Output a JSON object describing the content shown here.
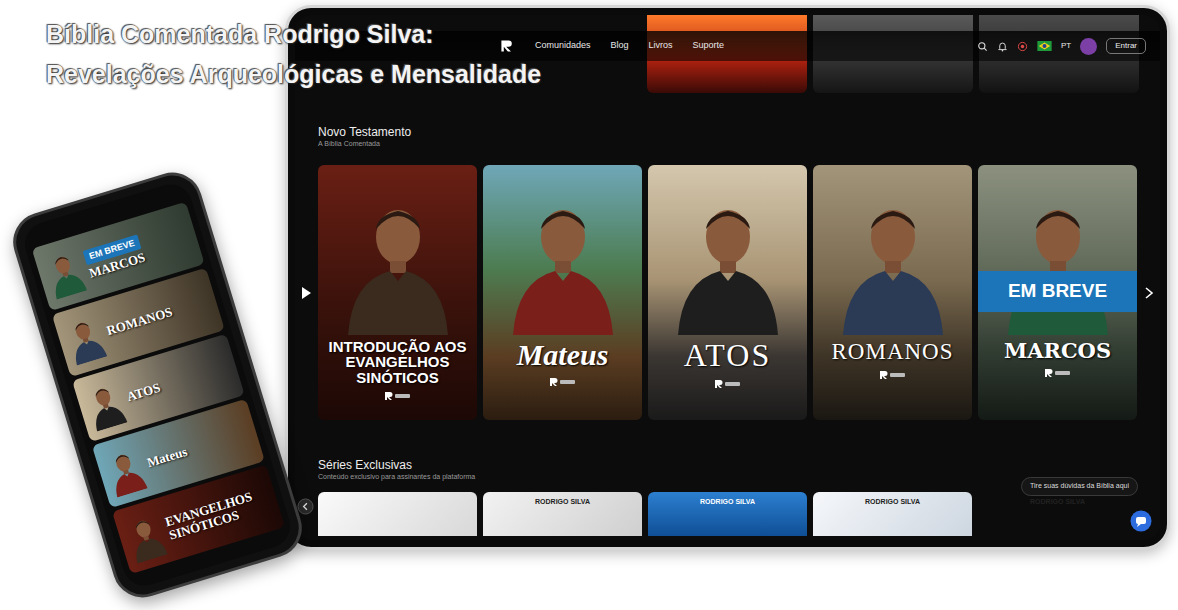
{
  "headline": {
    "line1": "Bíblia Comentada Rodrigo Silva:",
    "line2": "Revelações Arqueológicas e Mensalidade"
  },
  "nav": {
    "items": [
      "Comunidades",
      "Blog",
      "Livros",
      "Suporte"
    ],
    "language": "PT",
    "button": "Entrar"
  },
  "new_testament": {
    "title": "Novo Testamento",
    "subtitle": "A Bíblia Comentada",
    "cards": [
      {
        "title": "INTRODUÇÃO AOS EVANGELHOS SINÓTICOS",
        "coming_soon": false
      },
      {
        "title": "Mateus",
        "coming_soon": false
      },
      {
        "title": "ATOS",
        "coming_soon": false
      },
      {
        "title": "ROMANOS",
        "coming_soon": false
      },
      {
        "title": "MARCOS",
        "coming_soon": true,
        "badge": "EM BREVE"
      }
    ]
  },
  "series": {
    "title": "Séries Exclusivas",
    "subtitle": "Conteúdo exclusivo para assinantes da plataforma",
    "cards": [
      {
        "kind": "image"
      },
      {
        "kind": "labeled",
        "label": "RODRIGO SILVA"
      },
      {
        "kind": "labeled",
        "label": "RODRIGO SILVA"
      },
      {
        "kind": "labeled",
        "label": "RODRIGO SILVA"
      },
      {
        "kind": "labeled",
        "label": "RODRIGO SILVA"
      }
    ]
  },
  "help_tooltip": "Tire suas dúvidas da Bíblia aqui",
  "phone": {
    "tiles": [
      {
        "title": "MARCOS",
        "coming_soon": true,
        "badge": "EM BREVE"
      },
      {
        "title": "ROMANOS",
        "coming_soon": false
      },
      {
        "title": "ATOS",
        "coming_soon": false
      },
      {
        "title": "Mateus",
        "coming_soon": false
      },
      {
        "title": "EVANGELHOS SINÓTICOS",
        "coming_soon": false
      }
    ]
  }
}
